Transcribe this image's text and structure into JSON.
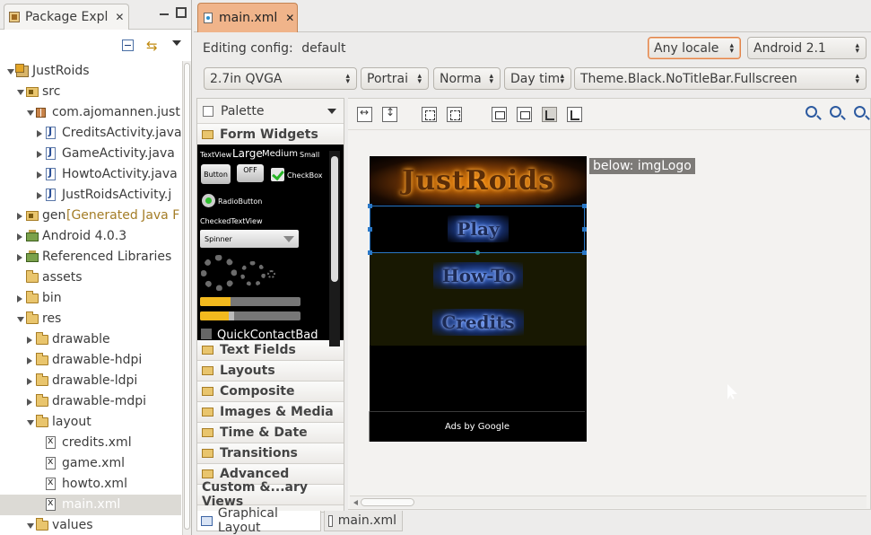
{
  "package_explorer": {
    "tab_title": "Package Expl",
    "tree": [
      {
        "label": "JustRoids",
        "level": 0,
        "icon": "project-icon",
        "twisty": "open"
      },
      {
        "label": "src",
        "level": 1,
        "icon": "source-folder-icon",
        "twisty": "open"
      },
      {
        "label": "com.ajomannen.just",
        "level": 2,
        "icon": "package-icon",
        "twisty": "open"
      },
      {
        "label": "CreditsActivity.java",
        "level": 3,
        "icon": "java-file-icon",
        "twisty": "closed"
      },
      {
        "label": "GameActivity.java",
        "level": 3,
        "icon": "java-file-icon",
        "twisty": "closed"
      },
      {
        "label": "HowtoActivity.java",
        "level": 3,
        "icon": "java-file-icon",
        "twisty": "closed"
      },
      {
        "label": "JustRoidsActivity.j",
        "level": 3,
        "icon": "java-file-icon",
        "twisty": "closed"
      },
      {
        "label": "gen",
        "deco": "[Generated Java F",
        "level": 1,
        "icon": "source-folder-icon",
        "twisty": "closed"
      },
      {
        "label": "Android 4.0.3",
        "level": 1,
        "icon": "library-icon",
        "twisty": "closed"
      },
      {
        "label": "Referenced Libraries",
        "level": 1,
        "icon": "library-icon",
        "twisty": "closed"
      },
      {
        "label": "assets",
        "level": 1,
        "icon": "folder-icon",
        "twisty": "none"
      },
      {
        "label": "bin",
        "level": 1,
        "icon": "folder-icon",
        "twisty": "closed"
      },
      {
        "label": "res",
        "level": 1,
        "icon": "folder-icon",
        "twisty": "open"
      },
      {
        "label": "drawable",
        "level": 2,
        "icon": "folder-icon",
        "twisty": "closed"
      },
      {
        "label": "drawable-hdpi",
        "level": 2,
        "icon": "folder-icon",
        "twisty": "closed"
      },
      {
        "label": "drawable-ldpi",
        "level": 2,
        "icon": "folder-icon",
        "twisty": "closed"
      },
      {
        "label": "drawable-mdpi",
        "level": 2,
        "icon": "folder-icon",
        "twisty": "closed"
      },
      {
        "label": "layout",
        "level": 2,
        "icon": "folder-icon",
        "twisty": "open"
      },
      {
        "label": "credits.xml",
        "level": 3,
        "icon": "xml-file-icon",
        "twisty": "none"
      },
      {
        "label": "game.xml",
        "level": 3,
        "icon": "xml-file-icon",
        "twisty": "none"
      },
      {
        "label": "howto.xml",
        "level": 3,
        "icon": "xml-file-icon",
        "twisty": "none"
      },
      {
        "label": "main.xml",
        "level": 3,
        "icon": "xml-file-icon",
        "twisty": "none",
        "selected": true
      },
      {
        "label": "values",
        "level": 2,
        "icon": "folder-icon",
        "twisty": "open"
      }
    ]
  },
  "editor": {
    "tab_title": "main.xml",
    "config_label": "Editing config:",
    "config_value": "default",
    "locale": "Any locale",
    "target": "Android 2.1",
    "device": "2.7in QVGA",
    "orientation": "Portrai",
    "mode": "Norma",
    "time": "Day tim",
    "theme": "Theme.Black.NoTitleBar.Fullscreen"
  },
  "palette": {
    "title": "Palette",
    "open_category": "Form Widgets",
    "categories": [
      "Text Fields",
      "Layouts",
      "Composite",
      "Images & Media",
      "Time & Date",
      "Transitions",
      "Advanced",
      "Custom &...ary Views"
    ],
    "preview": {
      "textview": "TextView",
      "large": "Large",
      "medium": "Medium",
      "small": "Small",
      "button": "Button",
      "toggle": "OFF",
      "checkbox": "CheckBox",
      "radio": "RadioButton",
      "checked_textview": "CheckedTextView",
      "spinner": "Spinner",
      "quick_contact": "QuickContactBad"
    }
  },
  "canvas": {
    "logo": "JustRoids",
    "buttons": [
      "Play",
      "How-To",
      "Credits"
    ],
    "ads": "Ads by Google",
    "below_tag": "below: imgLogo"
  },
  "bottom_tabs": [
    "Graphical Layout",
    "main.xml"
  ]
}
